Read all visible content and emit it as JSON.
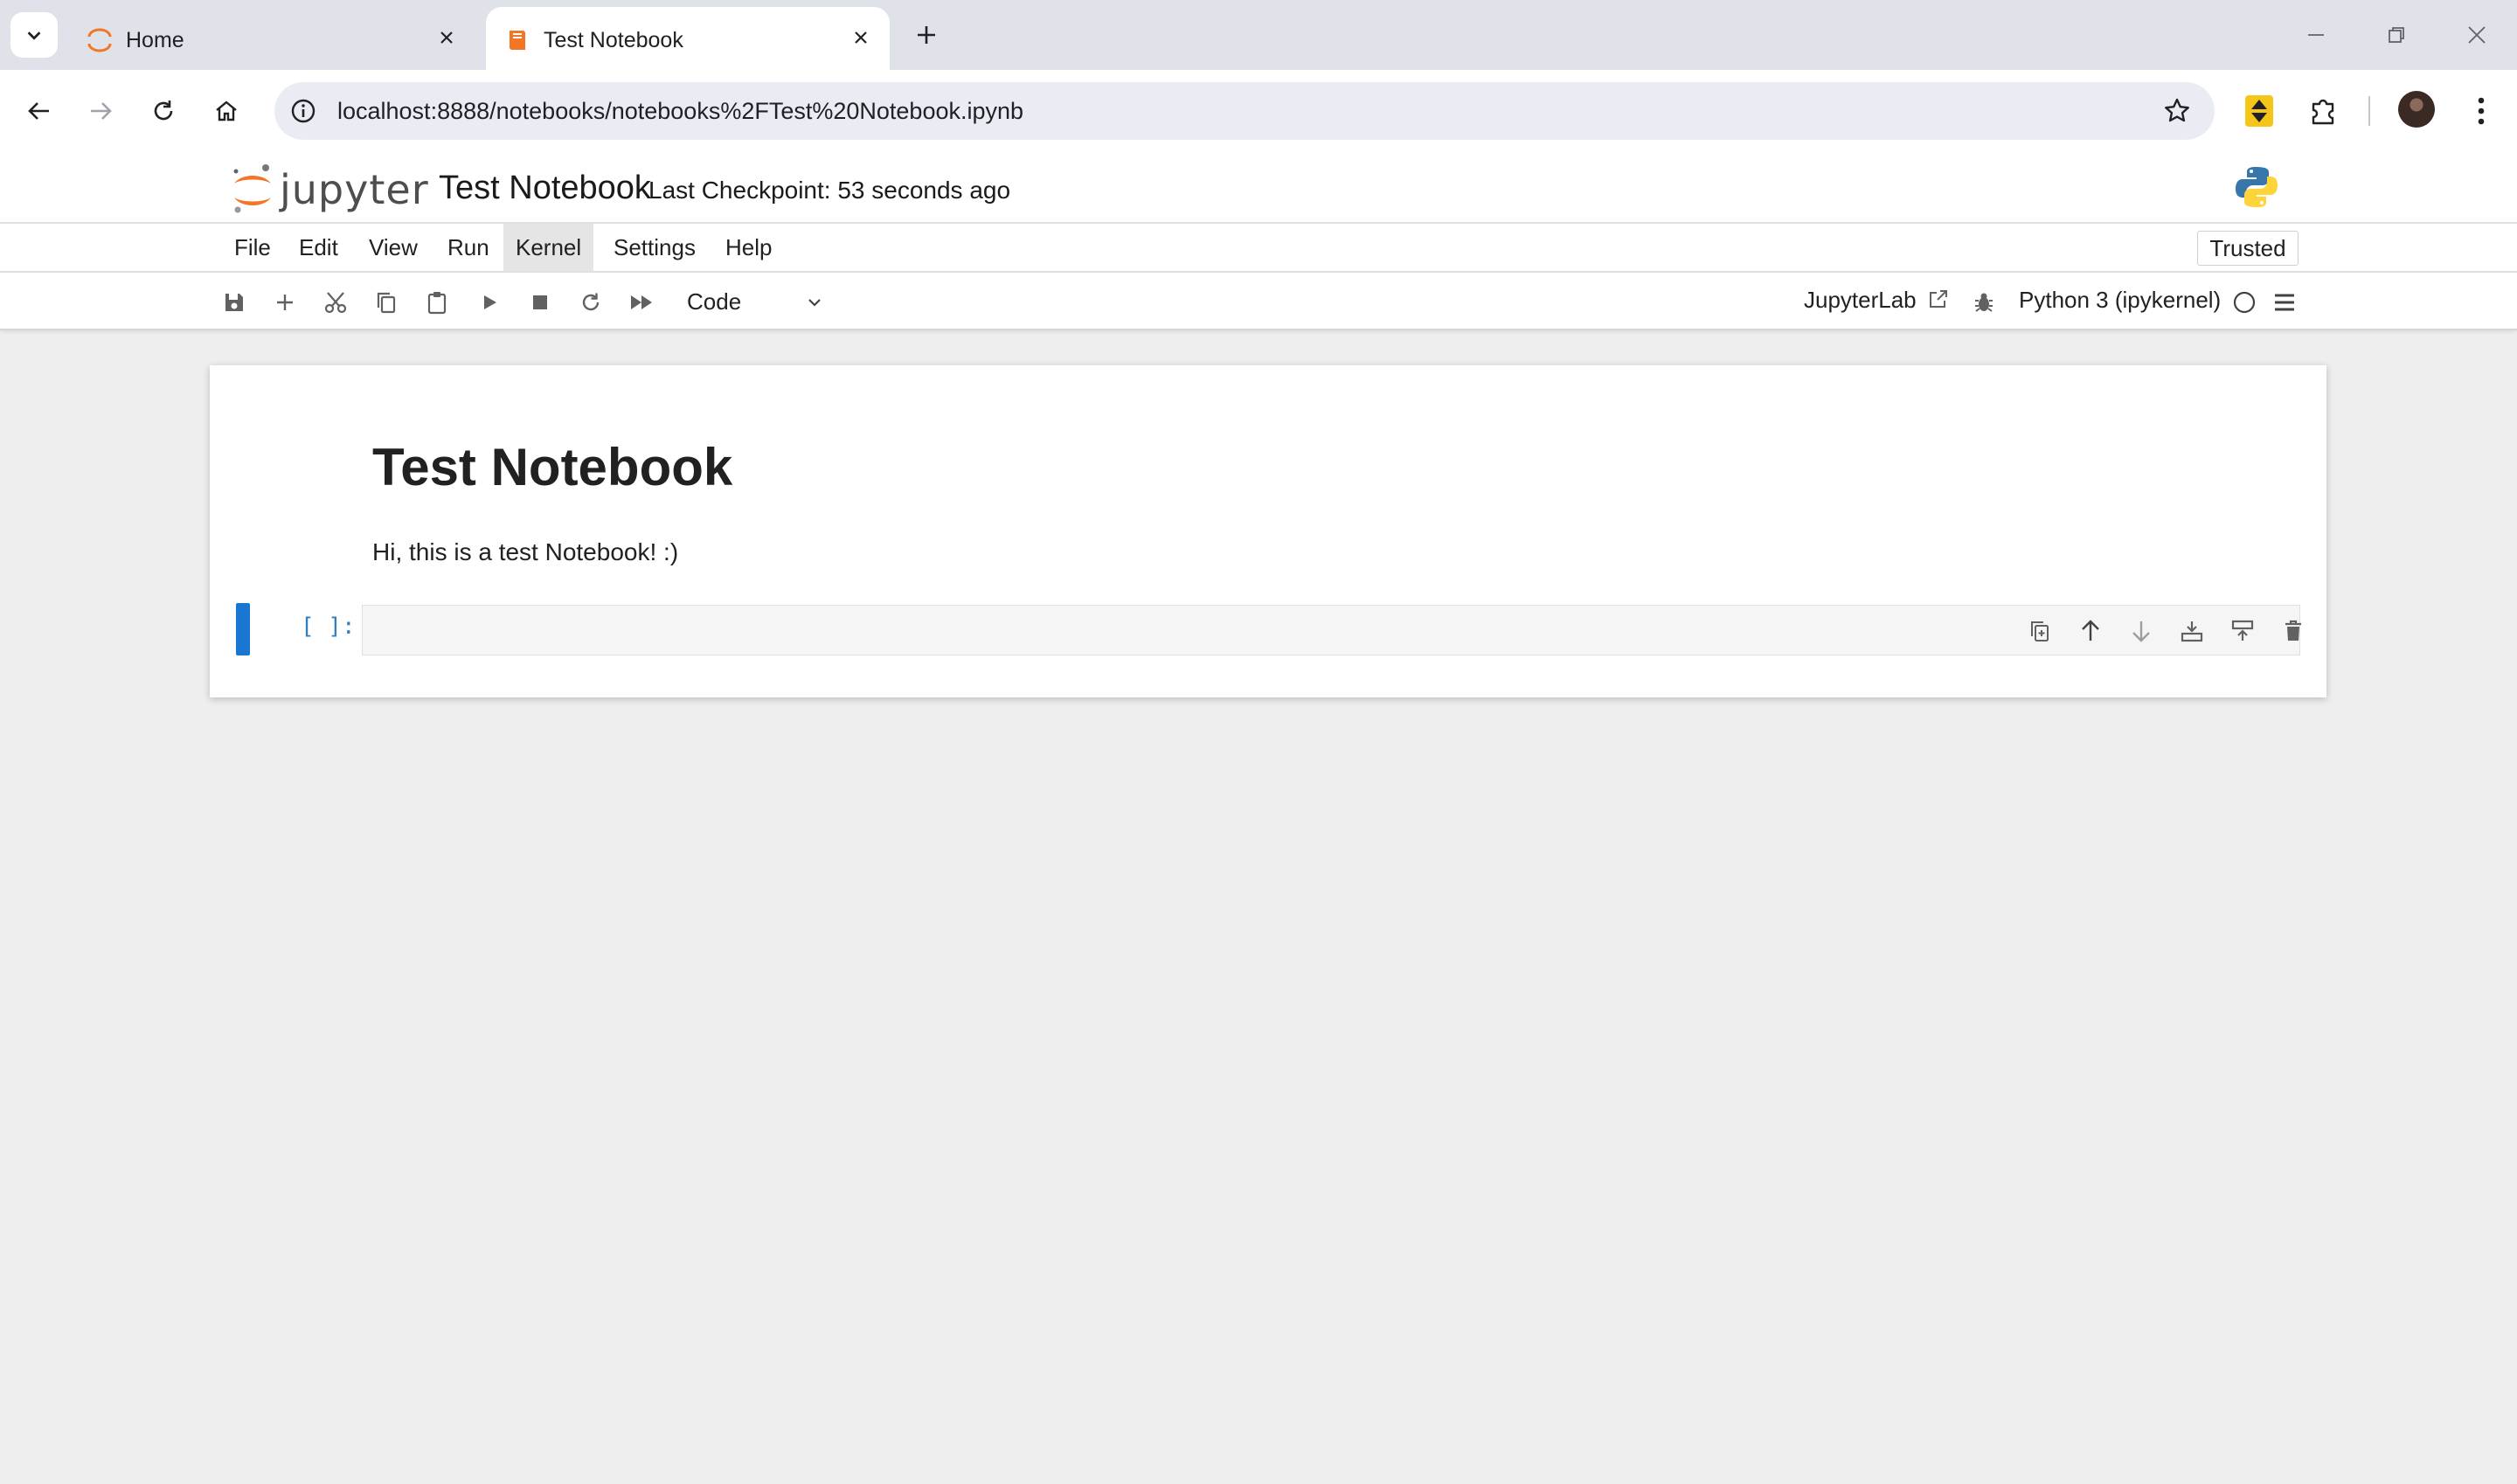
{
  "browser": {
    "tabs": [
      {
        "title": "Home",
        "active": false
      },
      {
        "title": "Test Notebook",
        "active": true
      }
    ],
    "url": "localhost:8888/notebooks/notebooks%2FTest%20Notebook.ipynb"
  },
  "jupyter": {
    "logo_text": "jupyter",
    "notebook_title": "Test Notebook",
    "checkpoint": "Last Checkpoint: 53 seconds ago",
    "menu": [
      "File",
      "Edit",
      "View",
      "Run",
      "Kernel",
      "Settings",
      "Help"
    ],
    "menu_active": "Kernel",
    "trusted": "Trusted",
    "cell_type": "Code",
    "jupyterlab_link": "JupyterLab",
    "kernel": "Python 3 (ipykernel)"
  },
  "notebook": {
    "heading": "Test Notebook",
    "paragraph": "Hi, this is a test Notebook! :)",
    "code_cell_prompt": "[ ]:"
  },
  "colors": {
    "accent": "#1976d2",
    "jupyter_orange": "#f37626",
    "prompt_blue": "#307fc1"
  },
  "icons": {
    "browser": [
      "tab-search-icon",
      "close-icon",
      "plus-icon",
      "minimize-icon",
      "restore-icon",
      "back-arrow-icon",
      "forward-arrow-icon",
      "reload-icon",
      "home-icon",
      "info-icon",
      "star-icon",
      "extension-icon",
      "puzzle-icon",
      "kebab-menu-icon"
    ],
    "notebook_toolbar": [
      "save-icon",
      "add-cell-icon",
      "cut-icon",
      "copy-icon",
      "paste-icon",
      "run-icon",
      "stop-icon",
      "restart-icon",
      "fast-forward-icon",
      "external-link-icon",
      "bug-icon",
      "kernel-idle-icon",
      "hamburger-icon"
    ],
    "cell_toolbar": [
      "duplicate-icon",
      "move-up-icon",
      "move-down-icon",
      "insert-below-icon",
      "insert-above-icon",
      "delete-icon"
    ]
  }
}
